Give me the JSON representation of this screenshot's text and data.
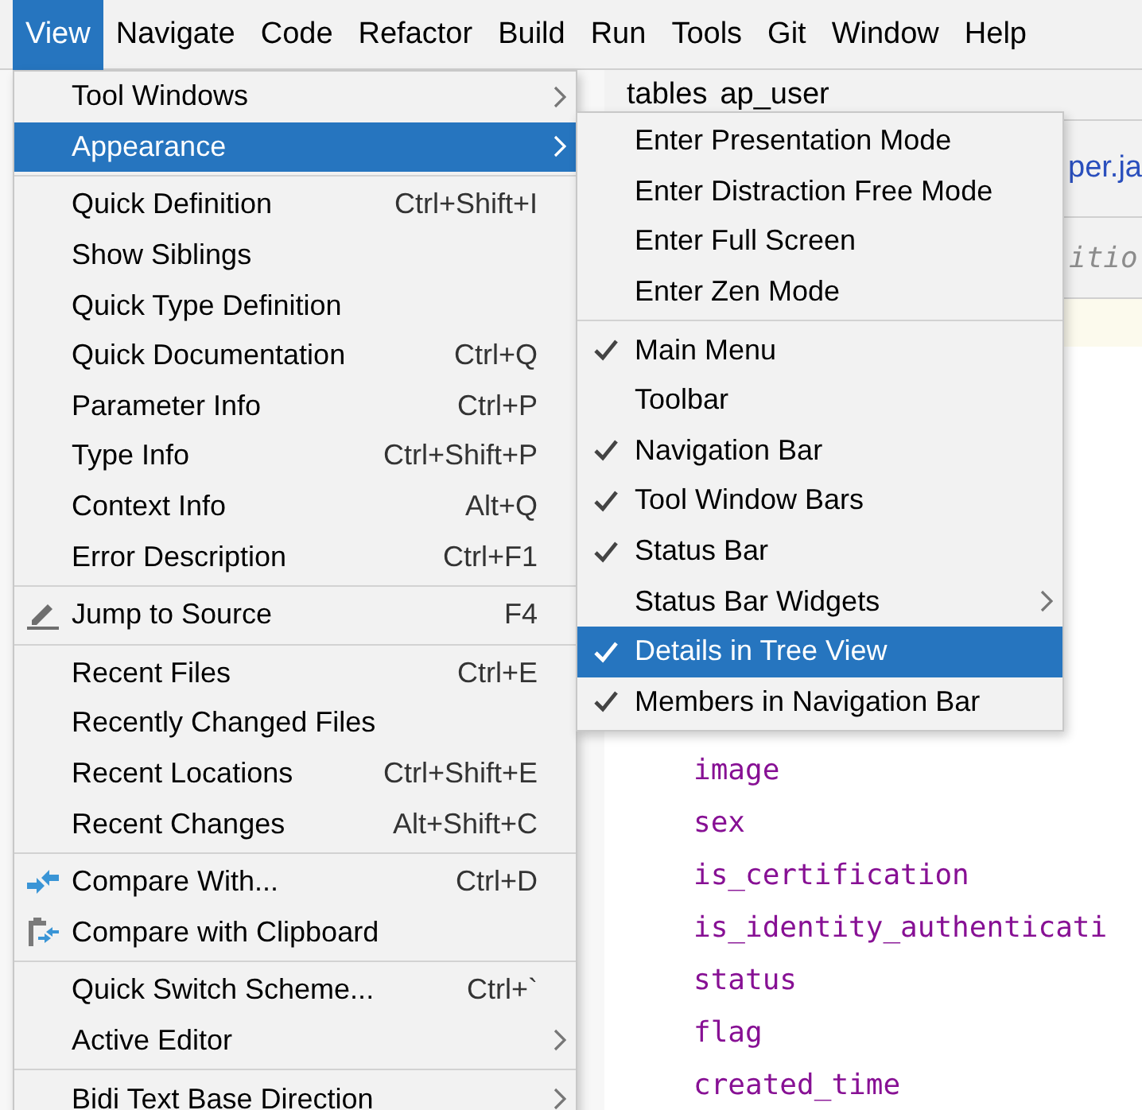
{
  "menu_bar": [
    {
      "label": "View",
      "selected": true
    },
    {
      "label": "Navigate",
      "selected": false
    },
    {
      "label": "Code",
      "selected": false
    },
    {
      "label": "Refactor",
      "selected": false
    },
    {
      "label": "Build",
      "selected": false
    },
    {
      "label": "Run",
      "selected": false
    },
    {
      "label": "Tools",
      "selected": false
    },
    {
      "label": "Git",
      "selected": false
    },
    {
      "label": "Window",
      "selected": false
    },
    {
      "label": "Help",
      "selected": false
    }
  ],
  "editor": {
    "breadcrumb": [
      "tables",
      "ap_user"
    ],
    "tab_text": "per.ja",
    "hint": "itio",
    "code_lines": [
      "image",
      "sex",
      "is_certification",
      "is_identity_authenticati",
      "status",
      "flag",
      "created_time"
    ]
  },
  "view_menu": [
    {
      "kind": "item",
      "label": "Tool Windows",
      "submenu": true,
      "selected": false
    },
    {
      "kind": "item",
      "label": "Appearance",
      "submenu": true,
      "selected": true
    },
    {
      "kind": "separator"
    },
    {
      "kind": "item",
      "label": "Quick Definition",
      "shortcut": "Ctrl+Shift+I",
      "selected": false
    },
    {
      "kind": "item",
      "label": "Show Siblings",
      "selected": false
    },
    {
      "kind": "item",
      "label": "Quick Type Definition",
      "selected": false
    },
    {
      "kind": "item",
      "label": "Quick Documentation",
      "shortcut": "Ctrl+Q",
      "selected": false
    },
    {
      "kind": "item",
      "label": "Parameter Info",
      "shortcut": "Ctrl+P",
      "selected": false
    },
    {
      "kind": "item",
      "label": "Type Info",
      "shortcut": "Ctrl+Shift+P",
      "selected": false
    },
    {
      "kind": "item",
      "label": "Context Info",
      "shortcut": "Alt+Q",
      "selected": false
    },
    {
      "kind": "item",
      "label": "Error Description",
      "shortcut": "Ctrl+F1",
      "selected": false
    },
    {
      "kind": "separator"
    },
    {
      "kind": "edit",
      "label": "Jump to Source",
      "shortcut": "F4",
      "selected": false
    },
    {
      "kind": "separator"
    },
    {
      "kind": "item",
      "label": "Recent Files",
      "shortcut": "Ctrl+E",
      "selected": false
    },
    {
      "kind": "item",
      "label": "Recently Changed Files",
      "selected": false
    },
    {
      "kind": "item",
      "label": "Recent Locations",
      "shortcut": "Ctrl+Shift+E",
      "selected": false
    },
    {
      "kind": "item",
      "label": "Recent Changes",
      "shortcut": "Alt+Shift+C",
      "selected": false
    },
    {
      "kind": "separator"
    },
    {
      "kind": "compare",
      "label": "Compare With...",
      "shortcut": "Ctrl+D",
      "selected": false
    },
    {
      "kind": "paste",
      "label": "Compare with Clipboard",
      "selected": false
    },
    {
      "kind": "separator"
    },
    {
      "kind": "item",
      "label": "Quick Switch Scheme...",
      "shortcut": "Ctrl+`",
      "selected": false
    },
    {
      "kind": "item",
      "label": "Active Editor",
      "submenu": true,
      "selected": false
    },
    {
      "kind": "separator"
    },
    {
      "kind": "item",
      "label": "Bidi Text Base Direction",
      "submenu": true,
      "selected": false
    }
  ],
  "appearance_menu": [
    {
      "kind": "item",
      "label": "Enter Presentation Mode",
      "checked": false,
      "selected": false
    },
    {
      "kind": "item",
      "label": "Enter Distraction Free Mode",
      "checked": false,
      "selected": false
    },
    {
      "kind": "item",
      "label": "Enter Full Screen",
      "checked": false,
      "selected": false
    },
    {
      "kind": "item",
      "label": "Enter Zen Mode",
      "checked": false,
      "selected": false
    },
    {
      "kind": "separator"
    },
    {
      "kind": "item",
      "label": "Main Menu",
      "checked": true,
      "selected": false
    },
    {
      "kind": "item",
      "label": "Toolbar",
      "checked": false,
      "selected": false
    },
    {
      "kind": "item",
      "label": "Navigation Bar",
      "checked": true,
      "selected": false
    },
    {
      "kind": "item",
      "label": "Tool Window Bars",
      "checked": true,
      "selected": false
    },
    {
      "kind": "item",
      "label": "Status Bar",
      "checked": true,
      "selected": false
    },
    {
      "kind": "item",
      "label": "Status Bar Widgets",
      "checked": false,
      "submenu": true,
      "selected": false
    },
    {
      "kind": "item",
      "label": "Details in Tree View",
      "checked": true,
      "selected": true
    },
    {
      "kind": "item",
      "label": "Members in Navigation Bar",
      "checked": true,
      "selected": false
    }
  ]
}
